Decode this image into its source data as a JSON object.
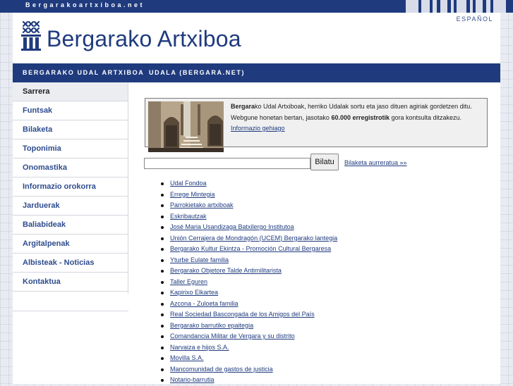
{
  "topbar": {
    "site": "Bergarakoartxiboa.net"
  },
  "header": {
    "lang_link": "ESPAÑOL",
    "logo_title": "Bergarako Artxiboa"
  },
  "nav": {
    "items": [
      "BERGARAKO UDAL ARTXIBOA",
      "UDALA (BERGARA.NET)"
    ]
  },
  "sidebar": {
    "items": [
      "Sarrera",
      "Funtsak",
      "Bilaketa",
      "Toponimia",
      "Onomastika",
      "Informazio orokorra",
      "Jarduerak",
      "Baliabideak",
      "Argitalpenak",
      "Albisteak - Noticias",
      "Kontaktua"
    ]
  },
  "intro": {
    "bold_start": "Bergara",
    "text_1": "ko Udal Artxiboak, herriko Udalak sortu eta jaso dituen agiriak gordetzen ditu. Webgune honetan bertan, jasotako ",
    "bold_count": "60.000 erregistrotik",
    "text_2": " gora kontsulta ditzakezu.",
    "more_link": "Informazio gehiago"
  },
  "search": {
    "value": "",
    "button": "Bilatu",
    "advanced_link": "Bilaketa aurreratua »»"
  },
  "fonds": [
    "Udal Fondoa",
    "Errege Mintegia",
    "Parrokietako artxiboak",
    "Eskribautzak",
    "José Maria Usandizaga Batxilergo Institutoa",
    "Unión Cerrajera de Mondragón (UCEM) Bergarako lantegia",
    "Bergarako Kultur Ekintza - Promoción Cultural Bergaresa",
    "Yturbe Eulate familia",
    "Bergarako Objetore Talde Antimilitarista",
    "Taller Eguren",
    "Kapirixo Elkartea",
    "Azcona - Zuloeta familia",
    "Real Sociedad Bascongada de los Amigos del País",
    "Bergarako barrutiko epaitegia",
    "Comandancia Militar de Vergara y su distrito",
    "Narvaiza e hijos S.A.",
    "Movilla S.A.",
    "Mancomunidad de gastos de justicia",
    "Notario-barrutia"
  ],
  "colors": {
    "brand_blue": "#1f3b7e",
    "link_blue": "#1f3b7e"
  }
}
